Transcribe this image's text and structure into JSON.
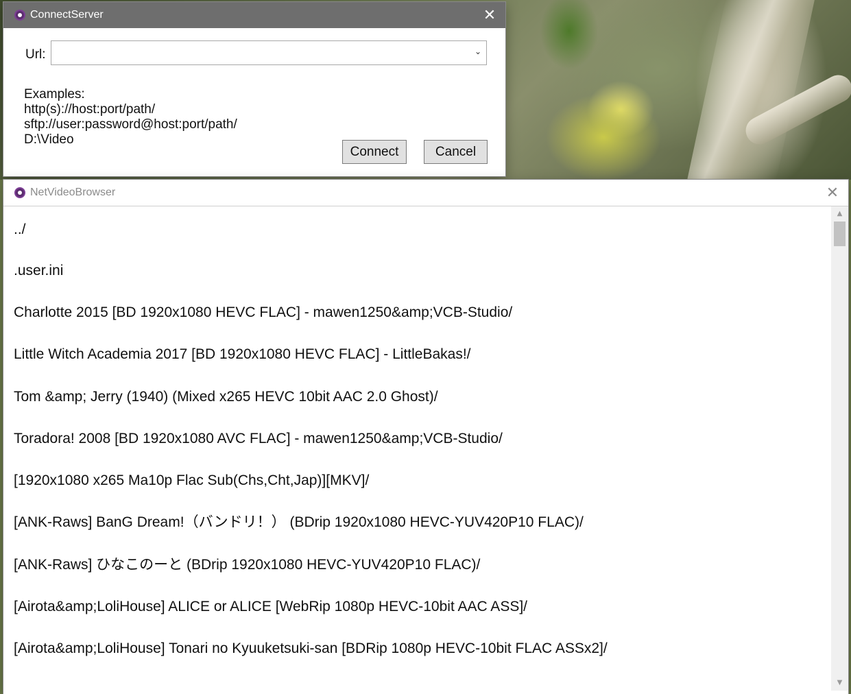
{
  "connect_dialog": {
    "title": "ConnectServer",
    "url_label": "Url:",
    "url_value": "",
    "examples": [
      "Examples:",
      "http(s)://host:port/path/",
      "sftp://user:password@host:port/path/",
      "D:\\Video"
    ],
    "connect_label": "Connect",
    "cancel_label": "Cancel",
    "close_glyph": "✕"
  },
  "browser": {
    "title": "NetVideoBrowser",
    "close_glyph": "✕",
    "items": [
      "../",
      ".user.ini",
      "Charlotte 2015 [BD 1920x1080 HEVC FLAC] - mawen1250&amp;VCB-Studio/",
      "Little Witch Academia 2017 [BD 1920x1080 HEVC FLAC] - LittleBakas!/",
      "Tom &amp; Jerry (1940) (Mixed x265 HEVC 10bit AAC 2.0 Ghost)/",
      "Toradora! 2008 [BD 1920x1080 AVC FLAC] - mawen1250&amp;VCB-Studio/",
      "[1920x1080 x265 Ma10p Flac Sub(Chs,Cht,Jap)][MKV]/",
      "[ANK-Raws] BanG Dream!（バンドリ！） (BDrip 1920x1080 HEVC-YUV420P10 FLAC)/",
      "[ANK-Raws] ひなこのーと (BDrip 1920x1080 HEVC-YUV420P10 FLAC)/",
      "[Airota&amp;LoliHouse] ALICE or ALICE [WebRip 1080p HEVC-10bit AAC ASS]/",
      "[Airota&amp;LoliHouse] Tonari no Kyuuketsuki-san [BDRip 1080p HEVC-10bit FLAC ASSx2]/"
    ]
  },
  "icons": {
    "app_icon": "app-logo-icon",
    "chevron": "chevron-down-icon",
    "scroll_up": "scroll-up-arrow-icon",
    "scroll_down": "scroll-down-arrow-icon"
  },
  "colors": {
    "dialog_titlebar": "#6e6e6e",
    "button_face": "#e1e1e1",
    "app_icon": "#5a2d6e"
  }
}
